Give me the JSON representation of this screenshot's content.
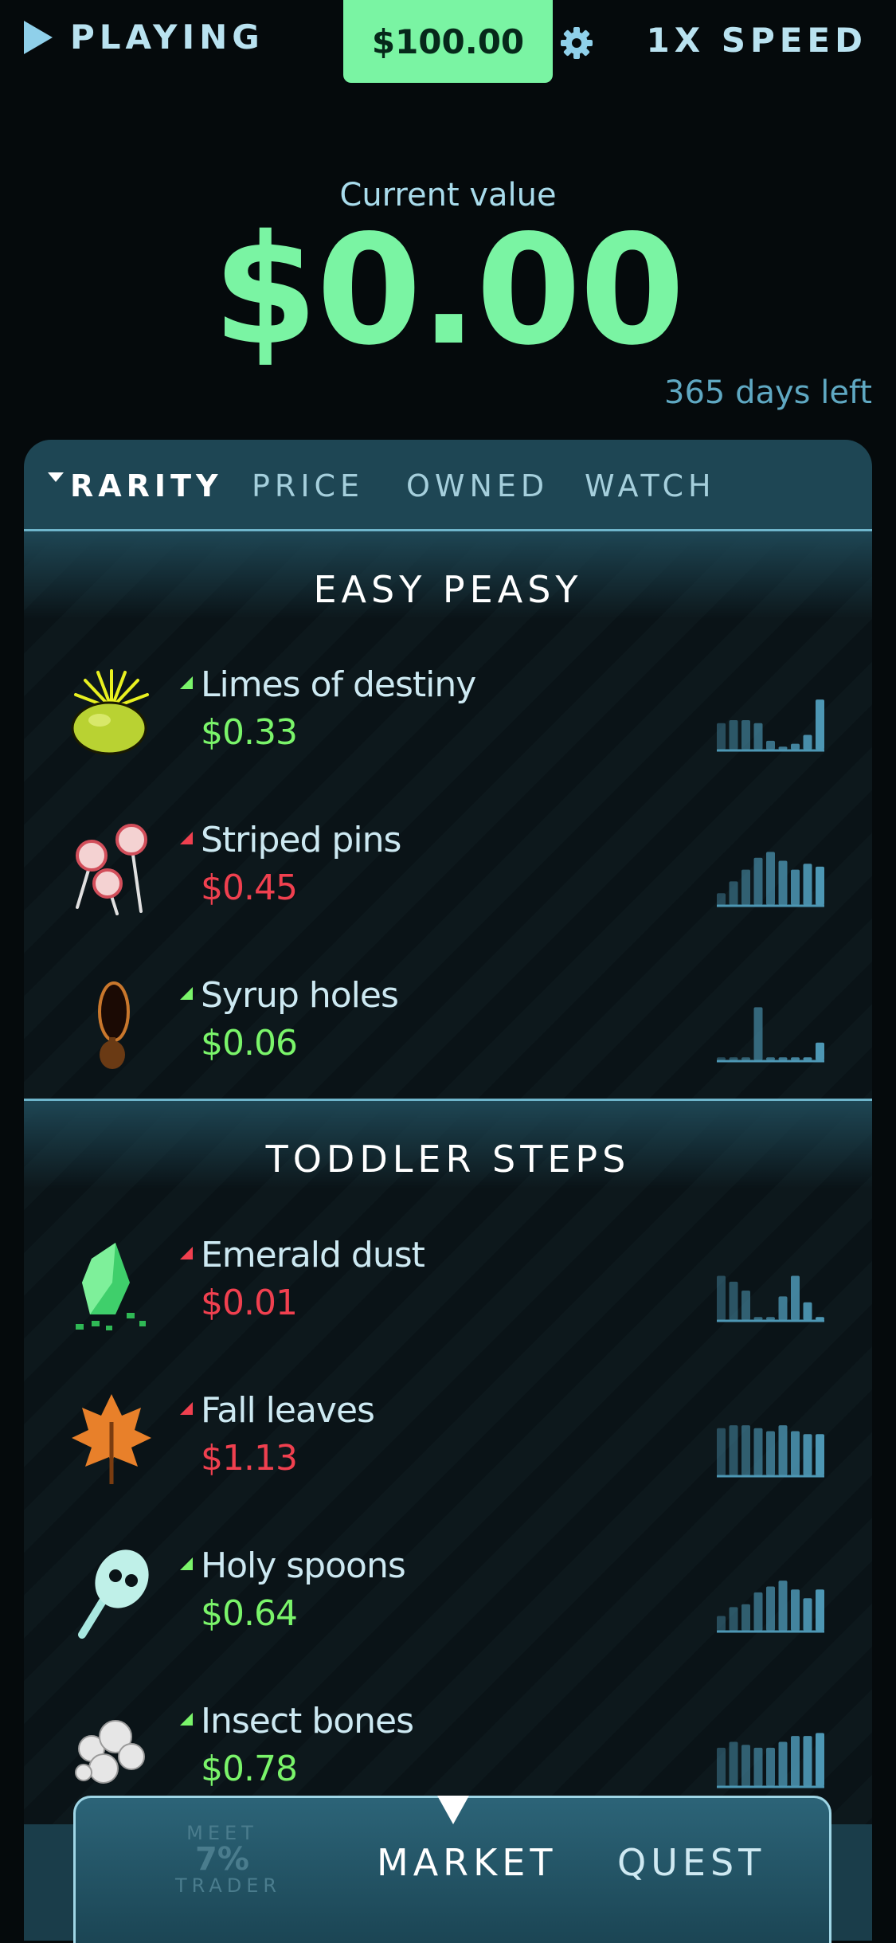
{
  "topbar": {
    "status_label": "PLAYING",
    "cash": "$100.00",
    "speed_label": "1X SPEED"
  },
  "summary": {
    "current_value_label": "Current value",
    "current_value": "$0.00",
    "days_left": "365 days left"
  },
  "sort_tabs": [
    {
      "label": "RARITY",
      "active": true
    },
    {
      "label": "PRICE",
      "active": false
    },
    {
      "label": "OWNED",
      "active": false
    },
    {
      "label": "WATCH",
      "active": false
    }
  ],
  "sections": [
    {
      "title": "EASY PEASY",
      "items": [
        {
          "name": "Limes of destiny",
          "price": "$0.33",
          "trend": "up",
          "icon": "lime-icon",
          "history": [
            0.45,
            0.5,
            0.5,
            0.45,
            0.15,
            0.05,
            0.1,
            0.25,
            0.85
          ]
        },
        {
          "name": "Striped pins",
          "price": "$0.45",
          "trend": "down",
          "icon": "pins-icon",
          "history": [
            0.2,
            0.4,
            0.6,
            0.8,
            0.9,
            0.75,
            0.6,
            0.7,
            0.65
          ]
        },
        {
          "name": "Syrup holes",
          "price": "$0.06",
          "trend": "up",
          "icon": "syrup-icon",
          "history": [
            0.05,
            0.05,
            0.05,
            0.9,
            0.05,
            0.05,
            0.05,
            0.05,
            0.3
          ]
        }
      ]
    },
    {
      "title": "TODDLER STEPS",
      "items": [
        {
          "name": "Emerald dust",
          "price": "$0.01",
          "trend": "down",
          "icon": "emerald-icon",
          "history": [
            0.75,
            0.65,
            0.5,
            0.05,
            0.05,
            0.4,
            0.75,
            0.3,
            0.05
          ]
        },
        {
          "name": "Fall leaves",
          "price": "$1.13",
          "trend": "down",
          "icon": "leaf-icon",
          "history": [
            0.8,
            0.85,
            0.85,
            0.8,
            0.75,
            0.85,
            0.75,
            0.7,
            0.7
          ]
        },
        {
          "name": "Holy spoons",
          "price": "$0.64",
          "trend": "up",
          "icon": "spoon-icon",
          "history": [
            0.25,
            0.4,
            0.45,
            0.65,
            0.75,
            0.85,
            0.7,
            0.55,
            0.7
          ]
        },
        {
          "name": "Insect bones",
          "price": "$0.78",
          "trend": "up",
          "icon": "bones-icon",
          "history": [
            0.65,
            0.75,
            0.7,
            0.65,
            0.65,
            0.75,
            0.85,
            0.85,
            0.9
          ]
        }
      ]
    }
  ],
  "nav": {
    "meet_top": "MEET",
    "meet_pct": "7%",
    "meet_bottom": "TRADER",
    "market_label": "MARKET",
    "quest_label": "QUEST"
  },
  "colors": {
    "accent": "#7af4a3",
    "up": "#7af46a",
    "down": "#f0404f",
    "panel": "#1e4654",
    "spark": "#4d97b4"
  }
}
